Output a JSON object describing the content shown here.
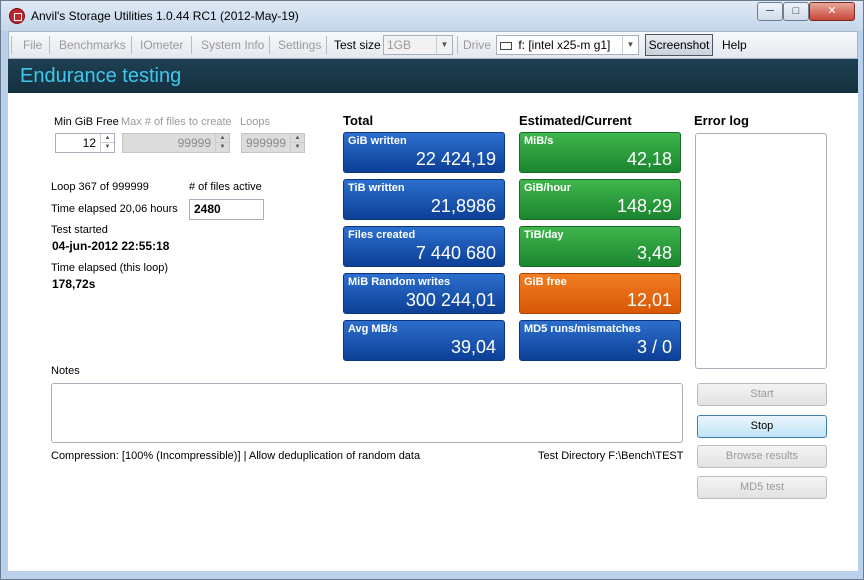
{
  "window": {
    "title": "Anvil's Storage Utilities 1.0.44 RC1 (2012-May-19)",
    "controls": {
      "minimize": "─",
      "maximize": "□",
      "close": "✕"
    }
  },
  "menu": {
    "file": "File",
    "benchmarks": "Benchmarks",
    "iometer": "IOmeter",
    "system_info": "System Info",
    "settings": "Settings",
    "test_size_label": "Test size",
    "test_size_value": "1GB",
    "drive_label": "Drive",
    "drive_value": "f: [intel x25-m g1]",
    "screenshot": "Screenshot",
    "help": "Help"
  },
  "header": {
    "title": "Endurance testing"
  },
  "params": {
    "min_gib_free_label": "Min GiB Free",
    "min_gib_free_value": "12",
    "max_files_label": "Max # of files to create",
    "max_files_value": "99999",
    "loops_label": "Loops",
    "loops_value": "999999"
  },
  "status": {
    "loop_text": "Loop 367 of 999999",
    "files_active_label": "# of files active",
    "files_active_value": "2480",
    "time_elapsed_text": "Time elapsed 20,06 hours",
    "test_started_label": "Test started",
    "test_started_value": "04-jun-2012 22:55:18",
    "loop_elapsed_label": "Time elapsed (this loop)",
    "loop_elapsed_value": "178,72s"
  },
  "totals": {
    "heading": "Total",
    "tiles": [
      {
        "label": "GiB written",
        "value": "22 424,19"
      },
      {
        "label": "TiB written",
        "value": "21,8986"
      },
      {
        "label": "Files created",
        "value": "7 440 680"
      },
      {
        "label": "MiB Random writes",
        "value": "300 244,01"
      },
      {
        "label": "Avg MB/s",
        "value": "39,04"
      }
    ]
  },
  "estimates": {
    "heading": "Estimated/Current",
    "tiles": [
      {
        "label": "MiB/s",
        "value": "42,18"
      },
      {
        "label": "GiB/hour",
        "value": "148,29"
      },
      {
        "label": "TiB/day",
        "value": "3,48"
      },
      {
        "label": "GiB free",
        "value": "12,01"
      },
      {
        "label": "MD5 runs/mismatches",
        "value": "3 / 0"
      }
    ]
  },
  "error_log": {
    "heading": "Error log"
  },
  "notes": {
    "label": "Notes"
  },
  "footer": {
    "compression_text": "Compression: [100% (Incompressible)] | Allow deduplication of random data",
    "test_directory_text": "Test Directory F:\\Bench\\TEST"
  },
  "buttons": {
    "start": "Start",
    "stop": "Stop",
    "browse": "Browse results",
    "md5": "MD5 test"
  },
  "colors": {
    "title_accent": "#3ec8ee",
    "tile_blue": "#1a56b4",
    "tile_green": "#2a9d3c",
    "tile_orange": "#e86a12"
  }
}
